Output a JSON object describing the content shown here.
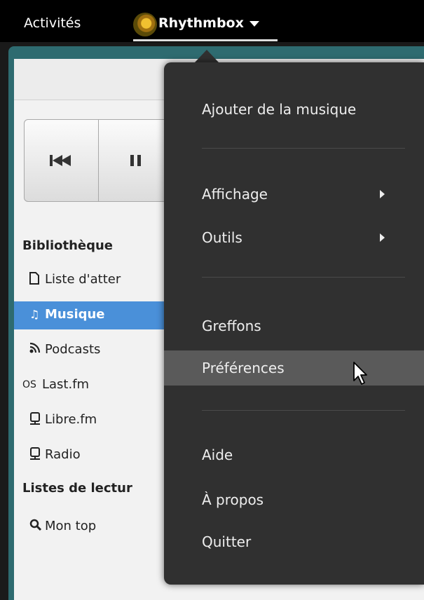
{
  "topbar": {
    "activities": "Activités",
    "app_name": "Rhythmbox"
  },
  "sidebar": {
    "library_heading": "Bibliothèque",
    "items": [
      {
        "label": "Liste d'atter",
        "icon": "document-icon"
      },
      {
        "label": "Musique",
        "icon": "music-note-icon",
        "active": true
      },
      {
        "label": "Podcasts",
        "icon": "rss-icon"
      },
      {
        "label": "Last.fm",
        "icon": "lastfm-icon"
      },
      {
        "label": "Libre.fm",
        "icon": "radio-icon"
      },
      {
        "label": "Radio",
        "icon": "radio-icon"
      }
    ],
    "playlists_heading": "Listes de lectur",
    "playlist_items": [
      {
        "label": "Mon top",
        "icon": "search-icon"
      }
    ]
  },
  "menu": {
    "items": [
      {
        "label": "Ajouter de la musique"
      },
      {
        "label": "Affichage",
        "submenu": true
      },
      {
        "label": "Outils",
        "submenu": true
      },
      {
        "label": "Greffons"
      },
      {
        "label": "Préférences",
        "hover": true
      },
      {
        "label": "Aide"
      },
      {
        "label": "À propos"
      },
      {
        "label": "Quitter"
      }
    ]
  },
  "colors": {
    "accent": "#4a90d9",
    "menu_bg": "#303030",
    "window_frame": "#2e6b70"
  }
}
